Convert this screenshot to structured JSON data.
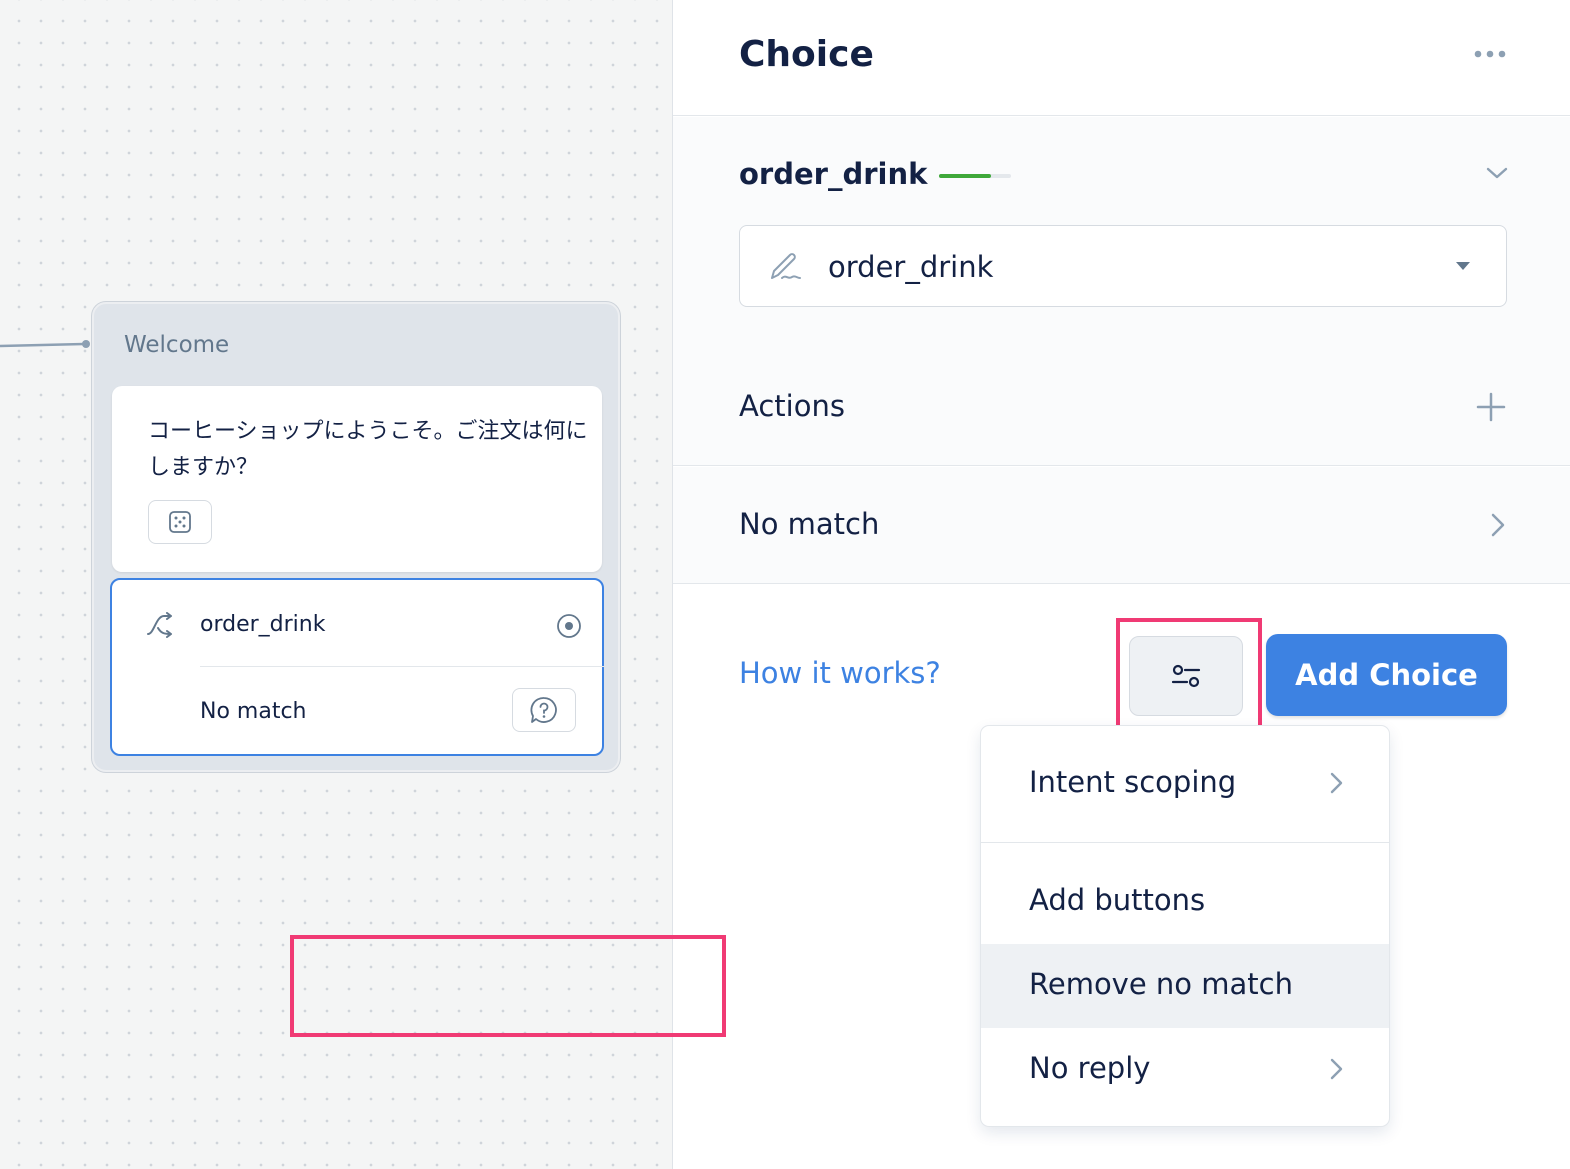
{
  "canvas": {
    "block": {
      "title": "Welcome",
      "speak_text": "コーヒーショップにようこそ。ご注文は何にしますか？",
      "choice_label": "order_drink",
      "no_match_label": "No match"
    }
  },
  "panel": {
    "title": "Choice",
    "intent": {
      "name": "order_drink",
      "completeness": 0.72,
      "select_value": "order_drink"
    },
    "actions_label": "Actions",
    "no_match_label": "No match",
    "how_it_works": "How it works?",
    "add_choice": "Add Choice",
    "menu": {
      "items": [
        {
          "label": "Intent scoping",
          "has_submenu": true
        },
        {
          "label": "Add buttons",
          "has_submenu": false
        },
        {
          "label": "Remove no match",
          "has_submenu": false,
          "hovered": true
        },
        {
          "label": "No reply",
          "has_submenu": true
        }
      ]
    }
  },
  "colors": {
    "accent": "#3d82e2",
    "highlight": "#f03a74",
    "progress": "#3fa83a",
    "text": "#132144"
  },
  "icons": [
    "shuffle-icon",
    "target-icon",
    "help-bubble-icon",
    "dice-icon",
    "more-icon",
    "chevron-down-icon",
    "pen-icon",
    "caret-down-icon",
    "plus-icon",
    "chevron-right-icon",
    "settings-sliders-icon"
  ]
}
